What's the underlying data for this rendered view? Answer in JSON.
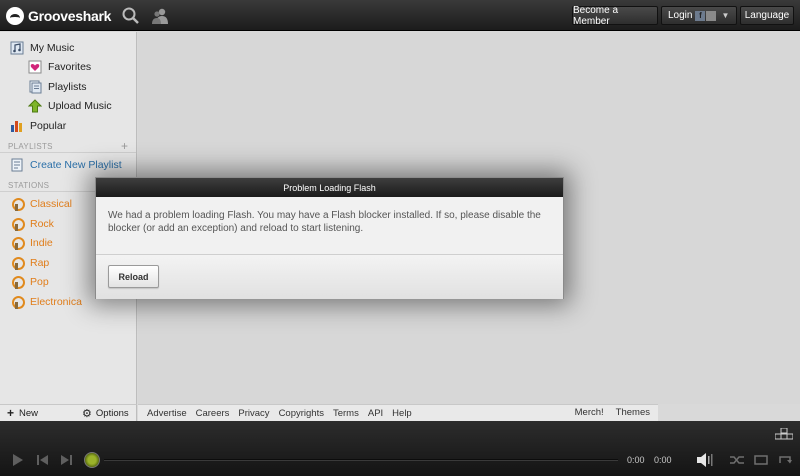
{
  "header": {
    "logo_text": "Grooveshark",
    "become_member_label": "Become a Member",
    "login_label": "Login",
    "fb_letter": "f",
    "language_label": "Language"
  },
  "sidebar": {
    "my_music": "My Music",
    "favorites": "Favorites",
    "playlists": "Playlists",
    "upload_music": "Upload Music",
    "popular": "Popular",
    "playlists_heading": "PLAYLISTS",
    "create_playlist": "Create New Playlist",
    "stations_heading": "STATIONS",
    "stations": [
      "Classical",
      "Rock",
      "Indie",
      "Rap",
      "Pop",
      "Electronica"
    ],
    "new_label": "New",
    "options_label": "Options"
  },
  "footer": {
    "links": [
      "Advertise",
      "Careers",
      "Privacy",
      "Copyrights",
      "Terms",
      "API",
      "Help"
    ],
    "merch": "Merch!",
    "themes": "Themes"
  },
  "player": {
    "elapsed": "0:00",
    "duration": "0:00"
  },
  "modal": {
    "title": "Problem Loading Flash",
    "message": "We had a problem loading Flash. You may have a Flash blocker installed. If so, please disable the blocker (or add an exception) and reload to start listening.",
    "reload_label": "Reload"
  },
  "colors": {
    "station_text": "#e07d1a",
    "create_playlist_text": "#2a6fa8",
    "scrubber": "#9ab22a"
  }
}
